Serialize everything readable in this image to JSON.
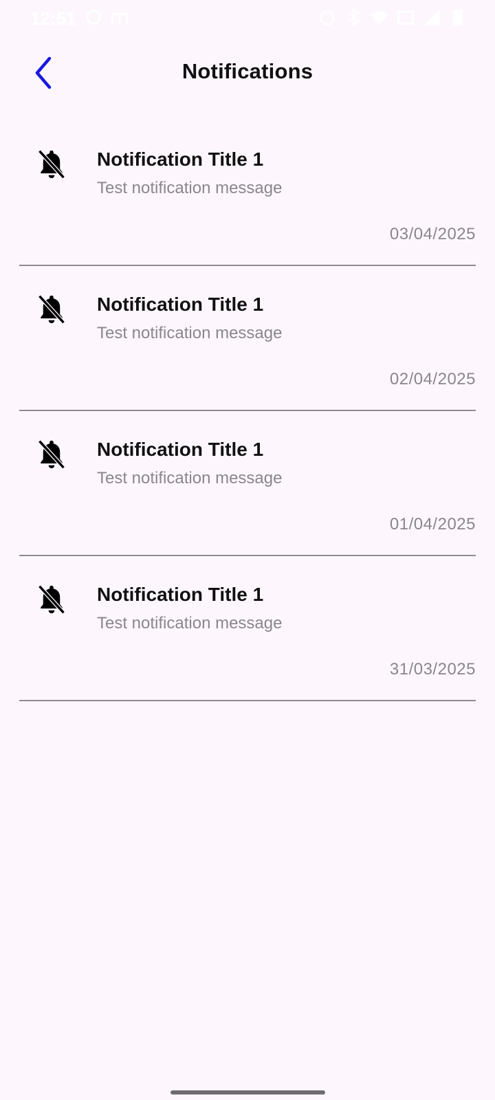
{
  "status_bar": {
    "time": "12:51",
    "left_icons": [
      "sync-icon",
      "m-app-icon"
    ],
    "right_icons": [
      "alarm-icon",
      "bluetooth-icon",
      "wifi-icon",
      "data-icon",
      "signal-icon",
      "battery-icon"
    ]
  },
  "header": {
    "back_icon": "chevron-left-icon",
    "title": "Notifications"
  },
  "notifications": [
    {
      "icon": "bell-off-icon",
      "title": "Notification Title 1",
      "message": "Test notification message",
      "date": "03/04/2025"
    },
    {
      "icon": "bell-off-icon",
      "title": "Notification Title 1",
      "message": "Test notification message",
      "date": "02/04/2025"
    },
    {
      "icon": "bell-off-icon",
      "title": "Notification Title 1",
      "message": "Test notification message",
      "date": "01/04/2025"
    },
    {
      "icon": "bell-off-icon",
      "title": "Notification Title 1",
      "message": "Test notification message",
      "date": "31/03/2025"
    }
  ],
  "colors": {
    "background": "#FDF7FD",
    "accent": "#1A17E0",
    "title_text": "#111111",
    "secondary_text": "#8A868C",
    "divider": "#8E8A8F"
  }
}
